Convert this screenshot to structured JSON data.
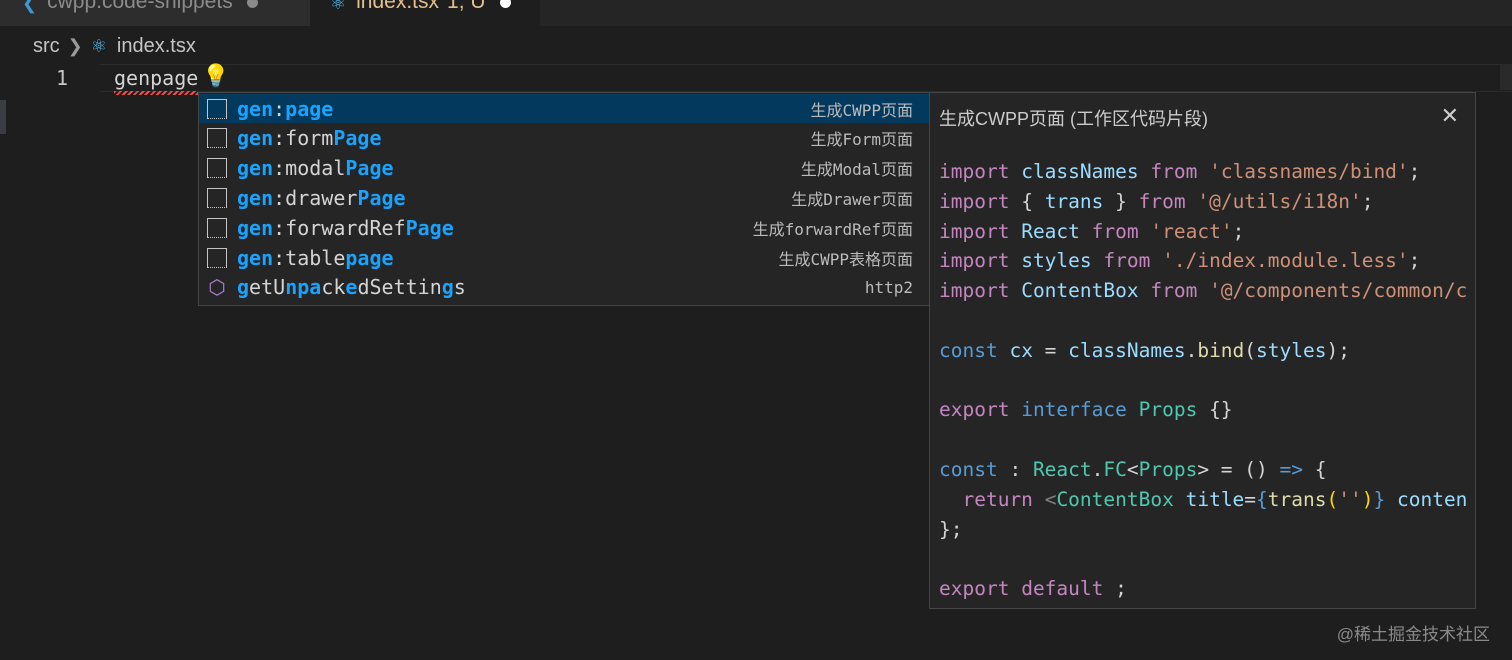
{
  "tabs": [
    {
      "label": "cwpp.code-snippets",
      "active": false
    },
    {
      "label": "index.tsx",
      "sub": "1, U",
      "active": true
    }
  ],
  "breadcrumb": {
    "folder": "src",
    "file": "index.tsx"
  },
  "editor": {
    "line_number": "1",
    "text": "genpage"
  },
  "suggestions": [
    {
      "parts": [
        {
          "t": "gen",
          "h": true
        },
        {
          "t": ":",
          "h": false
        },
        {
          "t": "page",
          "h": true
        }
      ],
      "detail": "生成CWPP页面",
      "selected": true,
      "icon": "snippet-icon"
    },
    {
      "parts": [
        {
          "t": "gen",
          "h": true
        },
        {
          "t": ":form",
          "h": false
        },
        {
          "t": "Page",
          "h": true
        }
      ],
      "detail": "生成Form页面",
      "icon": "snippet-icon"
    },
    {
      "parts": [
        {
          "t": "gen",
          "h": true
        },
        {
          "t": ":modal",
          "h": false
        },
        {
          "t": "Page",
          "h": true
        }
      ],
      "detail": "生成Modal页面",
      "icon": "snippet-icon"
    },
    {
      "parts": [
        {
          "t": "gen",
          "h": true
        },
        {
          "t": ":drawer",
          "h": false
        },
        {
          "t": "Page",
          "h": true
        }
      ],
      "detail": "生成Drawer页面",
      "icon": "snippet-icon"
    },
    {
      "parts": [
        {
          "t": "gen",
          "h": true
        },
        {
          "t": ":forwardRef",
          "h": false
        },
        {
          "t": "Page",
          "h": true
        }
      ],
      "detail": "生成forwardRef页面",
      "icon": "snippet-icon"
    },
    {
      "parts": [
        {
          "t": "gen",
          "h": true
        },
        {
          "t": ":table",
          "h": false
        },
        {
          "t": "page",
          "h": true
        }
      ],
      "detail": "生成CWPP表格页面",
      "icon": "snippet-icon"
    },
    {
      "parts": [
        {
          "t": "g",
          "h": true
        },
        {
          "t": "e",
          "h": false
        },
        {
          "t": "t",
          "h": false
        },
        {
          "t": "U",
          "h": false
        },
        {
          "t": "npa",
          "h": true
        },
        {
          "t": "ck",
          "h": false
        },
        {
          "t": "e",
          "h": true
        },
        {
          "t": "dSettin",
          "h": false
        },
        {
          "t": "g",
          "h": true
        },
        {
          "t": "s",
          "h": false
        }
      ],
      "detail": "http2",
      "icon": "cube-icon"
    }
  ],
  "details": {
    "title": "生成CWPP页面 (工作区代码片段)",
    "lines": [
      [
        [
          "k",
          "import"
        ],
        [
          "d",
          " "
        ],
        [
          "v",
          "classNames"
        ],
        [
          "d",
          " "
        ],
        [
          "k",
          "from"
        ],
        [
          "d",
          " "
        ],
        [
          "s",
          "'classnames/bind'"
        ],
        [
          "d",
          ";"
        ]
      ],
      [
        [
          "k",
          "import"
        ],
        [
          "d",
          " { "
        ],
        [
          "v",
          "trans"
        ],
        [
          "d",
          " } "
        ],
        [
          "k",
          "from"
        ],
        [
          "d",
          " "
        ],
        [
          "s",
          "'@/utils/i18n'"
        ],
        [
          "d",
          ";"
        ]
      ],
      [
        [
          "k",
          "import"
        ],
        [
          "d",
          " "
        ],
        [
          "v",
          "React"
        ],
        [
          "d",
          " "
        ],
        [
          "k",
          "from"
        ],
        [
          "d",
          " "
        ],
        [
          "s",
          "'react'"
        ],
        [
          "d",
          ";"
        ]
      ],
      [
        [
          "k",
          "import"
        ],
        [
          "d",
          " "
        ],
        [
          "v",
          "styles"
        ],
        [
          "d",
          " "
        ],
        [
          "k",
          "from"
        ],
        [
          "d",
          " "
        ],
        [
          "s",
          "'./index.module.less'"
        ],
        [
          "d",
          ";"
        ]
      ],
      [
        [
          "k",
          "import"
        ],
        [
          "d",
          " "
        ],
        [
          "v",
          "ContentBox"
        ],
        [
          "d",
          " "
        ],
        [
          "k",
          "from"
        ],
        [
          "d",
          " "
        ],
        [
          "s",
          "'@/components/common/c"
        ]
      ],
      [],
      [
        [
          "b",
          "const"
        ],
        [
          "d",
          " "
        ],
        [
          "v",
          "cx"
        ],
        [
          "d",
          " = "
        ],
        [
          "v",
          "classNames"
        ],
        [
          "d",
          "."
        ],
        [
          "f",
          "bind"
        ],
        [
          "d",
          "("
        ],
        [
          "v",
          "styles"
        ],
        [
          "d",
          ");"
        ]
      ],
      [],
      [
        [
          "k",
          "export"
        ],
        [
          "d",
          " "
        ],
        [
          "b",
          "interface"
        ],
        [
          "d",
          " "
        ],
        [
          "t",
          "Props"
        ],
        [
          "d",
          " {}"
        ]
      ],
      [],
      [
        [
          "b",
          "const"
        ],
        [
          "d",
          " : "
        ],
        [
          "t",
          "React"
        ],
        [
          "d",
          "."
        ],
        [
          "t",
          "FC"
        ],
        [
          "d",
          "<"
        ],
        [
          "t",
          "Props"
        ],
        [
          "d",
          "> = () "
        ],
        [
          "b",
          "=>"
        ],
        [
          "d",
          " {"
        ]
      ],
      [
        [
          "d",
          "  "
        ],
        [
          "k",
          "return"
        ],
        [
          "d",
          " "
        ],
        [
          "g",
          "<"
        ],
        [
          "t",
          "ContentBox"
        ],
        [
          "d",
          " "
        ],
        [
          "v",
          "title"
        ],
        [
          "d",
          "="
        ],
        [
          "b",
          "{"
        ],
        [
          "f",
          "trans"
        ],
        [
          "y",
          "("
        ],
        [
          "s",
          "''"
        ],
        [
          "y",
          ")"
        ],
        [
          "b",
          "}"
        ],
        [
          "d",
          " "
        ],
        [
          "v",
          "conten"
        ]
      ],
      [
        [
          "d",
          "};"
        ]
      ],
      [],
      [
        [
          "k",
          "export"
        ],
        [
          "d",
          " "
        ],
        [
          "k",
          "default"
        ],
        [
          "d",
          " ;"
        ]
      ]
    ]
  },
  "watermark": "@稀土掘金技术社区",
  "colors": {
    "selection": "#04395e",
    "highlight": "#18a3ff",
    "keyword": "#c586c0",
    "string": "#ce9178",
    "variable": "#9cdcfe",
    "type": "#4ec9b0"
  }
}
